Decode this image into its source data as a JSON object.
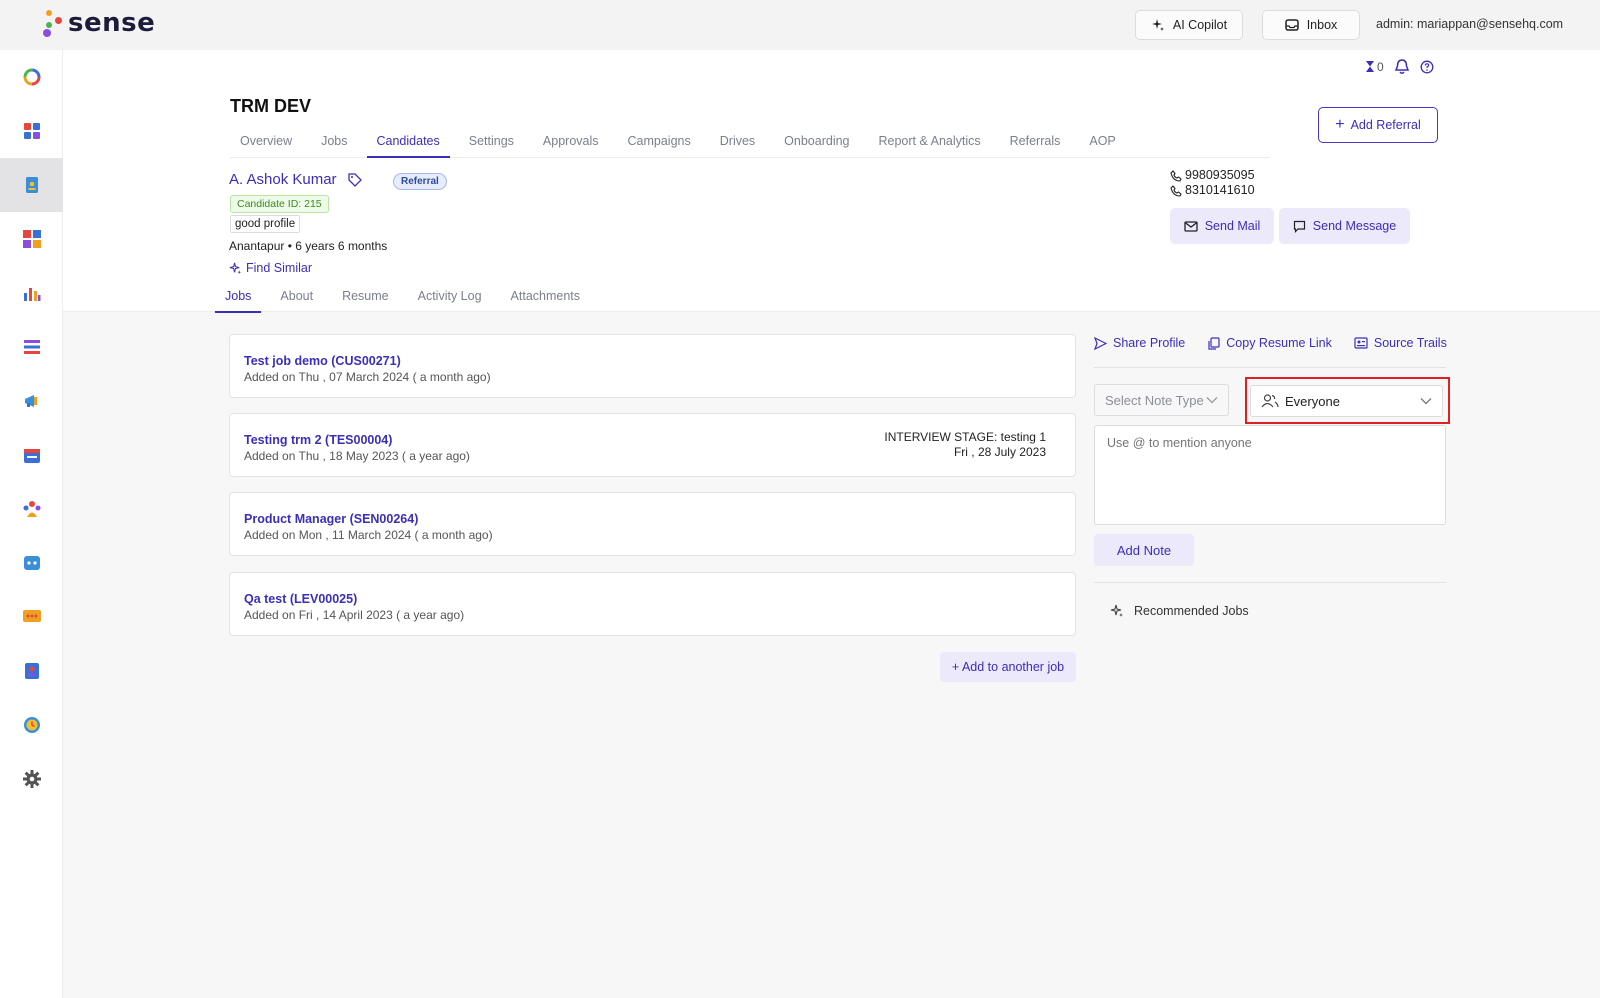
{
  "topbar": {
    "brand": "sense",
    "ai_copilot": "AI Copilot",
    "inbox": "Inbox",
    "admin": "admin: mariappan@sensehq.com"
  },
  "utility": {
    "hourglass_count": "0"
  },
  "page": {
    "title": "TRM DEV",
    "tabs": [
      "Overview",
      "Jobs",
      "Candidates",
      "Settings",
      "Approvals",
      "Campaigns",
      "Drives",
      "Onboarding",
      "Report & Analytics",
      "Referrals",
      "AOP"
    ],
    "active_tab": "Candidates",
    "add_referral": "Add Referral"
  },
  "candidate": {
    "name": "A. Ashok Kumar",
    "badge": "Referral",
    "id_label": "Candidate ID: 215",
    "tag": "good profile",
    "location": "Anantapur • 6 years 6 months",
    "find_similar": "Find Similar",
    "phones": [
      "9980935095",
      "8310141610"
    ],
    "send_mail": "Send Mail",
    "send_message": "Send Message"
  },
  "subtabs": [
    "Jobs",
    "About",
    "Resume",
    "Activity Log",
    "Attachments"
  ],
  "jobs": [
    {
      "title": "Test job demo (CUS00271)",
      "added": "Added on Thu , 07 March 2024 ( a month ago)",
      "stage": "",
      "stage_date": ""
    },
    {
      "title": "Testing trm 2 (TES00004)",
      "added": "Added on Thu , 18 May 2023 ( a year ago)",
      "stage": "INTERVIEW STAGE: testing 1",
      "stage_date": "Fri , 28 July 2023"
    },
    {
      "title": "Product Manager (SEN00264)",
      "added": "Added on Mon , 11 March 2024 ( a month ago)",
      "stage": "",
      "stage_date": ""
    },
    {
      "title": "Qa test (LEV00025)",
      "added": "Added on Fri , 14 April 2023 ( a year ago)",
      "stage": "",
      "stage_date": ""
    }
  ],
  "add_another_job": "+ Add to another job",
  "right_panel": {
    "share_profile": "Share Profile",
    "copy_resume_link": "Copy Resume Link",
    "source_trails": "Source Trails",
    "note_type_placeholder": "Select Note Type",
    "visibility": "Everyone",
    "note_placeholder": "Use @ to mention anyone",
    "add_note": "Add Note",
    "recommended_jobs": "Recommended Jobs"
  },
  "colors": {
    "accent": "#3a2fb8",
    "highlight": "#e02020"
  }
}
